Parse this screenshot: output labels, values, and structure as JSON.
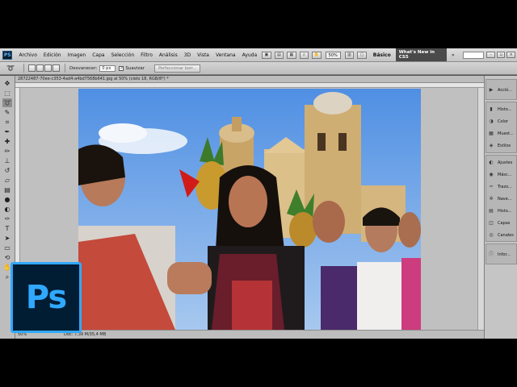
{
  "menubar": {
    "logo": "PS",
    "items": [
      "Archivo",
      "Edición",
      "Imagen",
      "Capa",
      "Selección",
      "Filtro",
      "Análisis",
      "3D",
      "Vista",
      "Ventana",
      "Ayuda"
    ],
    "zoom": "50%",
    "workspace_basic": "Básico",
    "workspace_new": "What's New in CS5",
    "workspace_more": "»"
  },
  "options": {
    "feather_label": "Desvanecer:",
    "feather_value": "0 px",
    "antialias_label": "Suavizar",
    "refine_label": "Perfeccionar borr..."
  },
  "document": {
    "tab_title": "28722487-70ee-c353-4ad4-a4bd7568b641.jpg al 50% (cielo 18, RGB/8*) *",
    "status_zoom": "50%",
    "status_doc": "Doc: 7,39 M/35,4 MB"
  },
  "panels": [
    {
      "label": "Acció...",
      "icon": "play-icon"
    },
    {
      "label": "Histo...",
      "icon": "histogram-icon"
    },
    {
      "label": "Color",
      "icon": "color-icon"
    },
    {
      "label": "Muest...",
      "icon": "swatches-icon"
    },
    {
      "label": "Estilos",
      "icon": "styles-icon"
    },
    {
      "label": "Ajustes",
      "icon": "adjustments-icon"
    },
    {
      "label": "Másc...",
      "icon": "masks-icon"
    },
    {
      "label": "Trazo...",
      "icon": "paths-icon"
    },
    {
      "label": "Nave...",
      "icon": "navigator-icon"
    },
    {
      "label": "Histo...",
      "icon": "history-icon"
    },
    {
      "label": "Capas",
      "icon": "layers-icon"
    },
    {
      "label": "Canales",
      "icon": "channels-icon"
    },
    {
      "label": "Infor...",
      "icon": "info-icon"
    }
  ],
  "logo_overlay": "Ps",
  "colors": {
    "ps_blue": "#31a8ff",
    "ps_dark": "#001d34",
    "sky": "#6fa3e4",
    "stone": "#d4b37a"
  }
}
